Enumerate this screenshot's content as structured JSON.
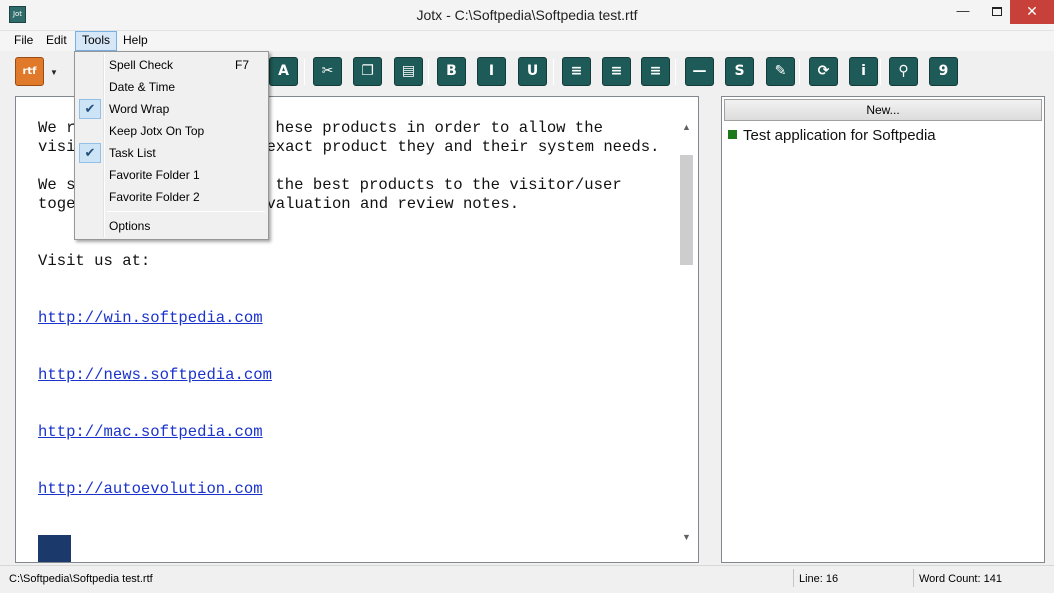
{
  "window": {
    "title": "Jotx - C:\\Softpedia\\Softpedia test.rtf",
    "icon_text": "Jot",
    "close_label": "✕",
    "minimize_label": "—"
  },
  "menubar": {
    "items": [
      "File",
      "Edit",
      "Tools",
      "Help"
    ],
    "active": "Tools"
  },
  "toolbar": {
    "rtf_label": "rtf",
    "buttons": [
      {
        "name": "font-icon",
        "glyph": "A"
      },
      {
        "name": "cut-icon",
        "glyph": "✂"
      },
      {
        "name": "copy-icon",
        "glyph": "❐"
      },
      {
        "name": "paste-icon",
        "glyph": "▤"
      },
      {
        "name": "bold-icon",
        "glyph": "B"
      },
      {
        "name": "italic-icon",
        "glyph": "I"
      },
      {
        "name": "underline-icon",
        "glyph": "U"
      },
      {
        "name": "align-left-icon",
        "glyph": "≡"
      },
      {
        "name": "align-center-icon",
        "glyph": "≡"
      },
      {
        "name": "align-right-icon",
        "glyph": "≡"
      },
      {
        "name": "horizontal-line-icon",
        "glyph": "—"
      },
      {
        "name": "spell-check-icon",
        "glyph": "S"
      },
      {
        "name": "pin-icon",
        "glyph": "✎"
      },
      {
        "name": "refresh-icon",
        "glyph": "⟳"
      },
      {
        "name": "info-icon",
        "glyph": "i"
      },
      {
        "name": "search-icon",
        "glyph": "⚲"
      },
      {
        "name": "calendar-icon",
        "glyph": "9"
      }
    ]
  },
  "tools_menu": {
    "items": [
      {
        "label": "Spell Check",
        "shortcut": "F7",
        "checked": false
      },
      {
        "label": "Date & Time",
        "shortcut": "",
        "checked": false
      },
      {
        "label": "Word Wrap",
        "shortcut": "",
        "checked": true
      },
      {
        "label": "Keep Jotx On Top",
        "shortcut": "",
        "checked": false
      },
      {
        "label": "Task List",
        "shortcut": "",
        "checked": true
      },
      {
        "label": "Favorite Folder 1",
        "shortcut": "",
        "checked": false
      },
      {
        "label": "Favorite Folder 2",
        "shortcut": "",
        "checked": false
      },
      {
        "label": "Options",
        "shortcut": "",
        "checked": false
      }
    ],
    "check_glyph": "✔"
  },
  "editor": {
    "line1": "We r",
    "line1b": "hese products in order to allow the",
    "line2": "visi",
    "line2b": "exact product they and their system needs.",
    "line3": "We s",
    "line3b": "the best products to the visitor/user",
    "line4": "toge",
    "line4b": "valuation and review notes.",
    "visit": "Visit us at:",
    "links": [
      "http://win.softpedia.com",
      "http://news.softpedia.com",
      "http://mac.softpedia.com",
      "http://autoevolution.com"
    ]
  },
  "task_panel": {
    "new_label": "New...",
    "tasks": [
      "Test application for Softpedia"
    ]
  },
  "statusbar": {
    "path": "C:\\Softpedia\\Softpedia test.rtf",
    "line": "Line: 16",
    "word_count": "Word Count: 141"
  }
}
